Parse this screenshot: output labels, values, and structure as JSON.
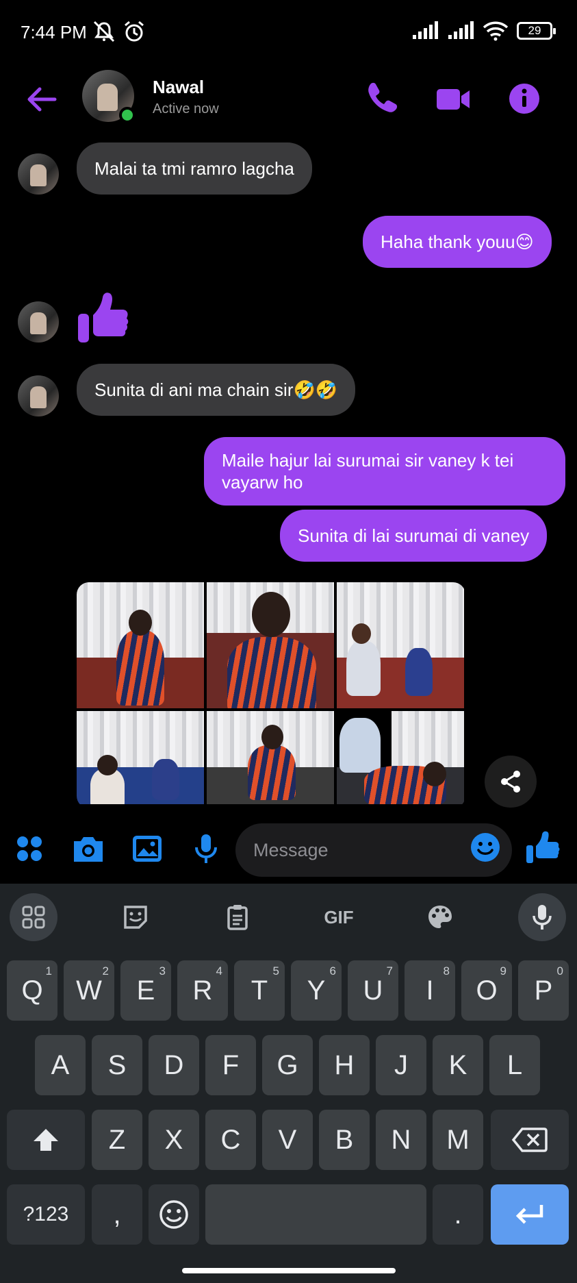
{
  "status_bar": {
    "time": "7:44 PM",
    "battery": "29"
  },
  "header": {
    "name": "Nawal",
    "status": "Active now"
  },
  "messages": {
    "m1": "Malai ta tmi ramro lagcha",
    "m2": "Haha thank youu😊",
    "m3": "Sunita di ani ma chain sir🤣🤣",
    "m4": "Maile hajur lai surumai sir vaney k tei vayarw ho",
    "m5": "Sunita di lai surumai di vaney"
  },
  "composer": {
    "placeholder": "Message"
  },
  "keyboard": {
    "toolbar": {
      "gif": "GIF"
    },
    "row1": [
      {
        "k": "Q",
        "n": "1"
      },
      {
        "k": "W",
        "n": "2"
      },
      {
        "k": "E",
        "n": "3"
      },
      {
        "k": "R",
        "n": "4"
      },
      {
        "k": "T",
        "n": "5"
      },
      {
        "k": "Y",
        "n": "6"
      },
      {
        "k": "U",
        "n": "7"
      },
      {
        "k": "I",
        "n": "8"
      },
      {
        "k": "O",
        "n": "9"
      },
      {
        "k": "P",
        "n": "0"
      }
    ],
    "row2": [
      "A",
      "S",
      "D",
      "F",
      "G",
      "H",
      "J",
      "K",
      "L"
    ],
    "row3": [
      "Z",
      "X",
      "C",
      "V",
      "B",
      "N",
      "M"
    ],
    "symbols": "?123",
    "comma": ",",
    "period": "."
  },
  "colors": {
    "accent": "#9b45f0",
    "incoming": "#3a3a3c",
    "enter": "#5e9cf0"
  }
}
